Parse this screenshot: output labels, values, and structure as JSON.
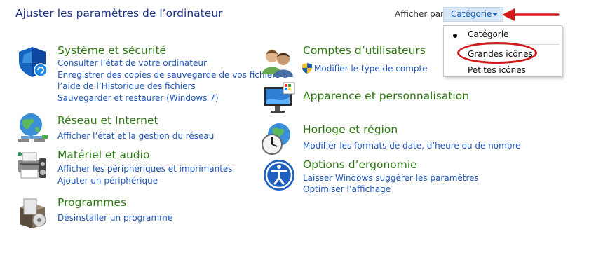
{
  "header": {
    "title": "Ajuster les paramètres de l’ordinateur",
    "view_by_label": "Afficher par :",
    "view_by_value": "Catégorie"
  },
  "dropdown": {
    "options": [
      {
        "label": "Catégorie",
        "selected": true
      },
      {
        "label": "Grandes icônes",
        "selected": false
      },
      {
        "label": "Petites icônes",
        "selected": false
      }
    ]
  },
  "categories": [
    {
      "title": "Système et sécurité",
      "icon": "shield-icon",
      "links": [
        "Consulter l’état de votre ordinateur",
        "Enregistrer des copies de sauvegarde de vos fichiers à",
        "l’aide de l’Historique des fichiers",
        "Sauvegarder et restaurer (Windows 7)"
      ]
    },
    {
      "title": "Réseau et Internet",
      "icon": "network-globe-icon",
      "links": [
        "Afficher l’état et la gestion du réseau"
      ]
    },
    {
      "title": "Matériel et audio",
      "icon": "printer-audio-icon",
      "links": [
        "Afficher les périphériques et imprimantes",
        "Ajouter un périphérique"
      ]
    },
    {
      "title": "Programmes",
      "icon": "programs-box-icon",
      "links": [
        "Désinstaller un programme"
      ]
    },
    {
      "title": "Comptes d’utilisateurs",
      "icon": "users-icon",
      "links": [
        "Modifier le type de compte"
      ]
    },
    {
      "title": "Apparence et personnalisation",
      "icon": "monitor-palette-icon",
      "links": []
    },
    {
      "title": "Horloge et région",
      "icon": "clock-globe-icon",
      "links": [
        "Modifier les formats de date, d’heure ou de nombre"
      ]
    },
    {
      "title": "Options d’ergonomie",
      "icon": "ease-of-access-icon",
      "links": [
        "Laisser Windows suggérer les paramètres",
        "Optimiser l’affichage"
      ]
    }
  ],
  "colors": {
    "category_title": "#2d7a11",
    "link": "#1f56b8",
    "header_title": "#1e3287",
    "annotation_red": "#d21a1a"
  }
}
